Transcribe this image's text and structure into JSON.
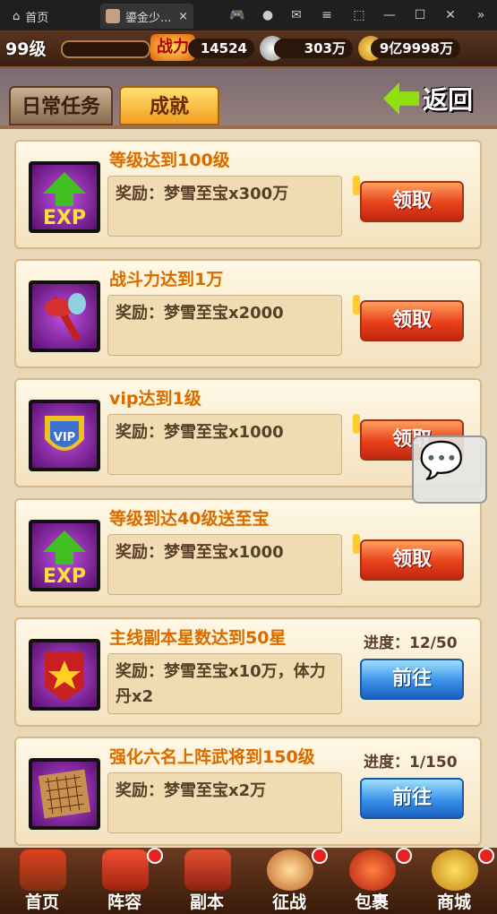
{
  "browser": {
    "home_label": "首页",
    "tab_title": "鎏金少...",
    "close": "×"
  },
  "status": {
    "level": "99级",
    "power_label": "战力",
    "power": "14524",
    "silver": "303万",
    "gold": "9亿9998万"
  },
  "tabs": {
    "daily": "日常任务",
    "achievement": "成就",
    "back": "返回"
  },
  "tasks": [
    {
      "title": "等级达到100级",
      "reward": "奖励：梦雪至宝x300万",
      "action": "领取",
      "progress": "",
      "icon": "exp-up-icon"
    },
    {
      "title": "战斗力达到1万",
      "reward": "奖励：梦雪至宝x2000",
      "action": "领取",
      "progress": "",
      "icon": "axe-icon"
    },
    {
      "title": "vip达到1级",
      "reward": "奖励：梦雪至宝x1000",
      "action": "领取",
      "progress": "",
      "icon": "vip-shield-icon"
    },
    {
      "title": "等级到达40级送至宝",
      "reward": "奖励：梦雪至宝x1000",
      "action": "领取",
      "progress": "",
      "icon": "exp-up-icon"
    },
    {
      "title": "主线副本星数达到50星",
      "reward": "奖励：梦雪至宝x10万，体力丹x2",
      "action": "前往",
      "progress": "进度：12/50",
      "icon": "star-banner-icon"
    },
    {
      "title": "强化六名上阵武将到150级",
      "reward": "奖励：梦雪至宝x2万",
      "action": "前往",
      "progress": "进度：1/150",
      "icon": "go-board-icon"
    }
  ],
  "nav": [
    {
      "label": "首页"
    },
    {
      "label": "阵容"
    },
    {
      "label": "副本"
    },
    {
      "label": "征战"
    },
    {
      "label": "包裹"
    },
    {
      "label": "商城"
    }
  ],
  "colors": {
    "claim_button": "#e8401a",
    "go_button": "#3a90e8",
    "title_text": "#d86a00",
    "card_bg": "#fff8e6"
  }
}
